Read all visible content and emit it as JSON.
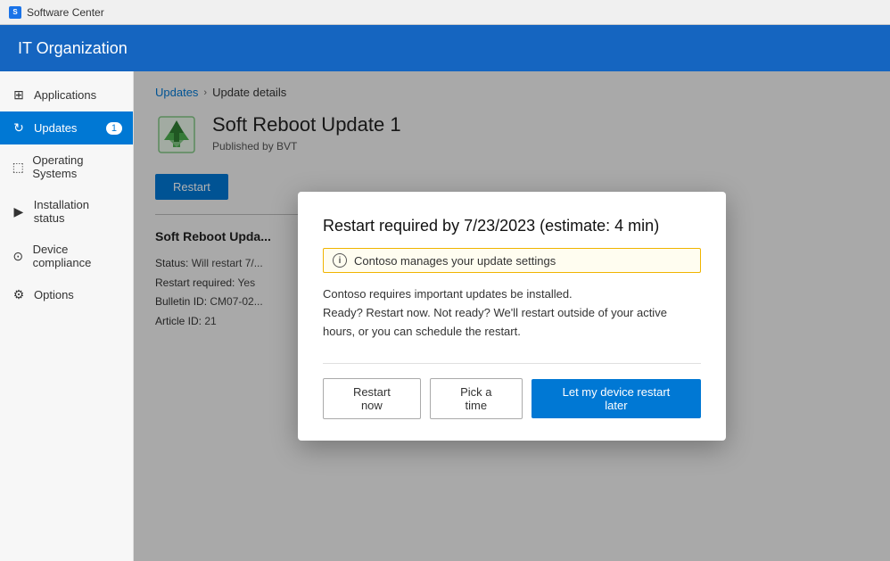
{
  "titleBar": {
    "icon": "SC",
    "title": "Software Center"
  },
  "header": {
    "orgName": "IT Organization"
  },
  "sidebar": {
    "items": [
      {
        "id": "applications",
        "label": "Applications",
        "icon": "⊞",
        "active": false,
        "badge": null
      },
      {
        "id": "updates",
        "label": "Updates",
        "icon": "↻",
        "active": true,
        "badge": "1"
      },
      {
        "id": "operating-systems",
        "label": "Operating Systems",
        "icon": "⬚",
        "active": false,
        "badge": null
      },
      {
        "id": "installation-status",
        "label": "Installation status",
        "icon": "▶",
        "active": false,
        "badge": null
      },
      {
        "id": "device-compliance",
        "label": "Device compliance",
        "icon": "⊙",
        "active": false,
        "badge": null
      },
      {
        "id": "options",
        "label": "Options",
        "icon": "⚙",
        "active": false,
        "badge": null
      }
    ]
  },
  "breadcrumb": {
    "links": [
      {
        "label": "Updates",
        "href": "#"
      }
    ],
    "separator": ">",
    "current": "Update details"
  },
  "updateDetail": {
    "title": "Soft Reboot Update 1",
    "publisher": "Published by BVT",
    "restartButtonLabel": "Restart",
    "sectionTitle": "Soft Reboot Upda...",
    "details": [
      {
        "label": "Status:",
        "value": "Will restart 7/..."
      },
      {
        "label": "Restart required:",
        "value": "Yes"
      },
      {
        "label": "Bulletin ID:",
        "value": "CM07-02..."
      },
      {
        "label": "Article ID:",
        "value": "21"
      }
    ]
  },
  "modal": {
    "title": "Restart required by 7/23/2023 (estimate: 4 min)",
    "managedNotice": "Contoso manages your update settings",
    "body1": "Contoso requires important updates be installed.",
    "body2": "Ready? Restart now. Not ready? We'll restart outside of your active hours, or you can schedule the restart.",
    "buttons": {
      "restartNow": "Restart now",
      "pickTime": "Pick a time",
      "restartLater": "Let my device restart later"
    }
  }
}
